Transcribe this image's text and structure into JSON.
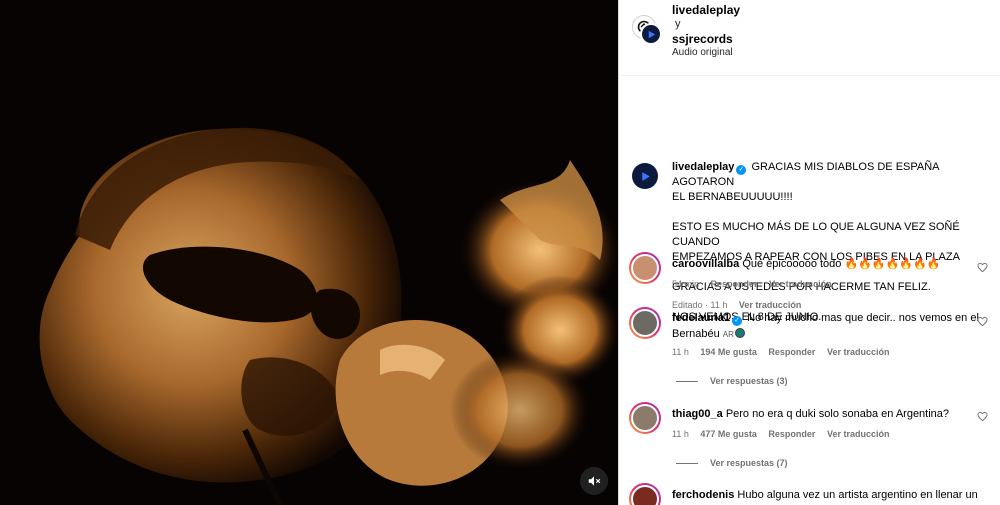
{
  "video": {
    "mute_icon": "speaker-muted-icon"
  },
  "header": {
    "user1": "livedaleplay",
    "connector": "y",
    "user2": "ssjrecords",
    "audio": "Audio original"
  },
  "caption": {
    "username": "livedaleplay",
    "lines": [
      "GRACIAS MIS DIABLOS DE ESPAÑA AGOTARON",
      "EL BERNABEUUUUU!!!!",
      "ESTO ES MUCHO MÁS DE LO QUE ALGUNA VEZ SOÑÉ CUANDO",
      "EMPEZAMOS A RAPEAR CON LOS PIBES EN LA PLAZA",
      "GRACIAS A USTEDES POR HACERME TAN FELIZ.",
      "NOS VEMOS EL 8 DE JUNIO."
    ],
    "meta_edited": "Editado · 11 h",
    "meta_translate": "Ver traducción"
  },
  "comments": [
    {
      "username": "caroovillalba",
      "text": "Qué épicooooo todo 🔥🔥🔥🔥🔥🔥🔥",
      "time": "54 min",
      "likes": "",
      "reply": "Responder",
      "translate": "Ver traducción",
      "replies": ""
    },
    {
      "username": "fedelauria1",
      "text": "No hay mucho mas que decir.. nos vemos en el Bernabéu",
      "flag": "AR",
      "time": "11 h",
      "likes": "194 Me gusta",
      "reply": "Responder",
      "translate": "Ver traducción",
      "replies": "Ver respuestas (3)"
    },
    {
      "username": "thiag00_a",
      "text": "Pero no era q duki solo sonaba en Argentina?",
      "time": "11 h",
      "likes": "477 Me gusta",
      "reply": "Responder",
      "translate": "Ver traducción",
      "replies": "Ver respuestas (7)"
    },
    {
      "username": "ferchodenis",
      "text": "Hubo alguna vez un artista argentino en llenar un",
      "time": "",
      "likes": "",
      "reply": "",
      "translate": "",
      "replies": ""
    }
  ],
  "colors": {
    "accent": "#0095f6",
    "muted_text": "#737373",
    "story_ring_start": "#f9a935",
    "story_ring_end": "#a02fb8"
  }
}
